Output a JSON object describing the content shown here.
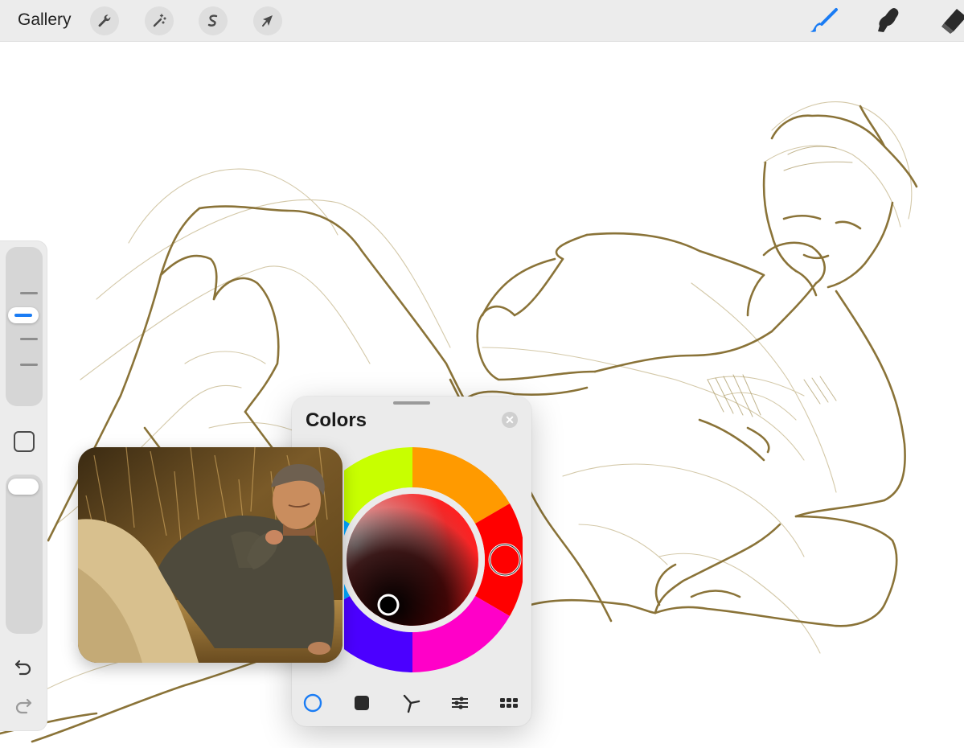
{
  "toolbar": {
    "gallery_label": "Gallery",
    "left_tools": [
      {
        "name": "actions",
        "icon": "wrench-icon"
      },
      {
        "name": "adjustments",
        "icon": "magic-wand-icon"
      },
      {
        "name": "selection",
        "icon": "selection-s-icon"
      },
      {
        "name": "transform",
        "icon": "arrow-cursor-icon"
      }
    ],
    "right_tools": [
      {
        "name": "brush",
        "icon": "brush-icon",
        "active": true
      },
      {
        "name": "smudge",
        "icon": "smudge-icon",
        "active": false
      },
      {
        "name": "eraser",
        "icon": "eraser-icon",
        "active": false
      }
    ],
    "active_color": "#1a7cf4"
  },
  "sidebar": {
    "brush_size_level": 0.4,
    "opacity_level": 0.97,
    "modify_button": "modify-square-icon",
    "undo_icon": "undo-icon",
    "redo_icon": "redo-icon"
  },
  "colors_panel": {
    "title": "Colors",
    "mode": "disc",
    "selected_hue": "#ff0000",
    "selected_color": "#000000",
    "tabs": [
      {
        "name": "disc",
        "icon": "disc-icon",
        "active": true
      },
      {
        "name": "classic",
        "icon": "square-icon",
        "active": false
      },
      {
        "name": "harmony",
        "icon": "harmony-icon",
        "active": false
      },
      {
        "name": "value",
        "icon": "sliders-icon",
        "active": false
      },
      {
        "name": "palettes",
        "icon": "grid-icon",
        "active": false
      }
    ]
  },
  "canvas": {
    "sketch_color": "#8a7338",
    "content": "sketch-drawing"
  },
  "reference": {
    "content": "reference-photo-man-reclining"
  }
}
